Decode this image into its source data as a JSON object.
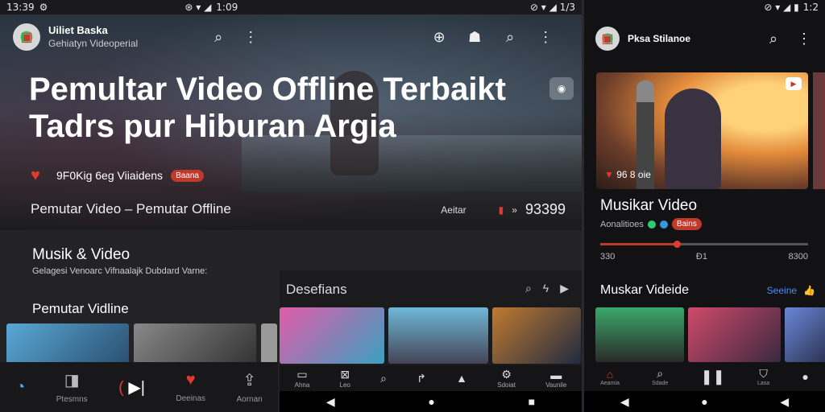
{
  "left": {
    "status": {
      "time": "13:39",
      "right": "1:09"
    },
    "app": {
      "title": "Uiliet Baska",
      "subtitle": "Gehiatyn Videoperial"
    },
    "hero": {
      "title": "Pemultar Video Offline Terbaikt Tadrs pur Hiburan Argia",
      "meta_text": "9F0Kig 6eg Viiaidens",
      "meta_badge": "Baana",
      "subtitle": "Pemutar Video  –  Pemutar Offline",
      "right_label": "Aeitar",
      "right_count": "93399"
    },
    "section1": {
      "title": "Musik & Video",
      "description": "Gelagesi Venoarc Vifnaalajk Dubdard Varne:"
    },
    "section2": {
      "title": "Pemutar Vidline"
    },
    "panel2": {
      "title": "Desefians"
    },
    "bottom_nav": [
      {
        "label": "",
        "icon": "home-icon"
      },
      {
        "label": "Ptesmns",
        "icon": "film-icon"
      },
      {
        "label": "",
        "icon": "skip-icon"
      },
      {
        "label": "Deeinas",
        "icon": "heart-icon"
      },
      {
        "label": "Aornan",
        "icon": "share-icon"
      }
    ],
    "mid_nav": [
      {
        "label": "Ahna"
      },
      {
        "label": "Leo"
      },
      {
        "label": ""
      },
      {
        "label": ""
      },
      {
        "label": ""
      },
      {
        "label": "Sdoiat"
      },
      {
        "label": "Vaunile"
      }
    ]
  },
  "right": {
    "status": {
      "time": "1:2"
    },
    "app": {
      "title": "Pksa Stilanoe"
    },
    "hero_label": "96 8 oie",
    "title": "Musikar Video",
    "meta": "Aonalitioes",
    "meta_badge": "Bains",
    "progress": {
      "fraction": 0.37,
      "start": "330",
      "middle": "Ð1",
      "end": "8300"
    },
    "section": "Muskar Videide",
    "see_all": "Seeine",
    "nav": [
      {
        "label": "Aeamia"
      },
      {
        "label": "Sdade"
      },
      {
        "label": ""
      },
      {
        "label": "Lasa"
      },
      {
        "label": ""
      }
    ]
  },
  "colors": {
    "accent": "#e03a2e",
    "link": "#4a8cff",
    "bg": "#1a1a1d"
  }
}
